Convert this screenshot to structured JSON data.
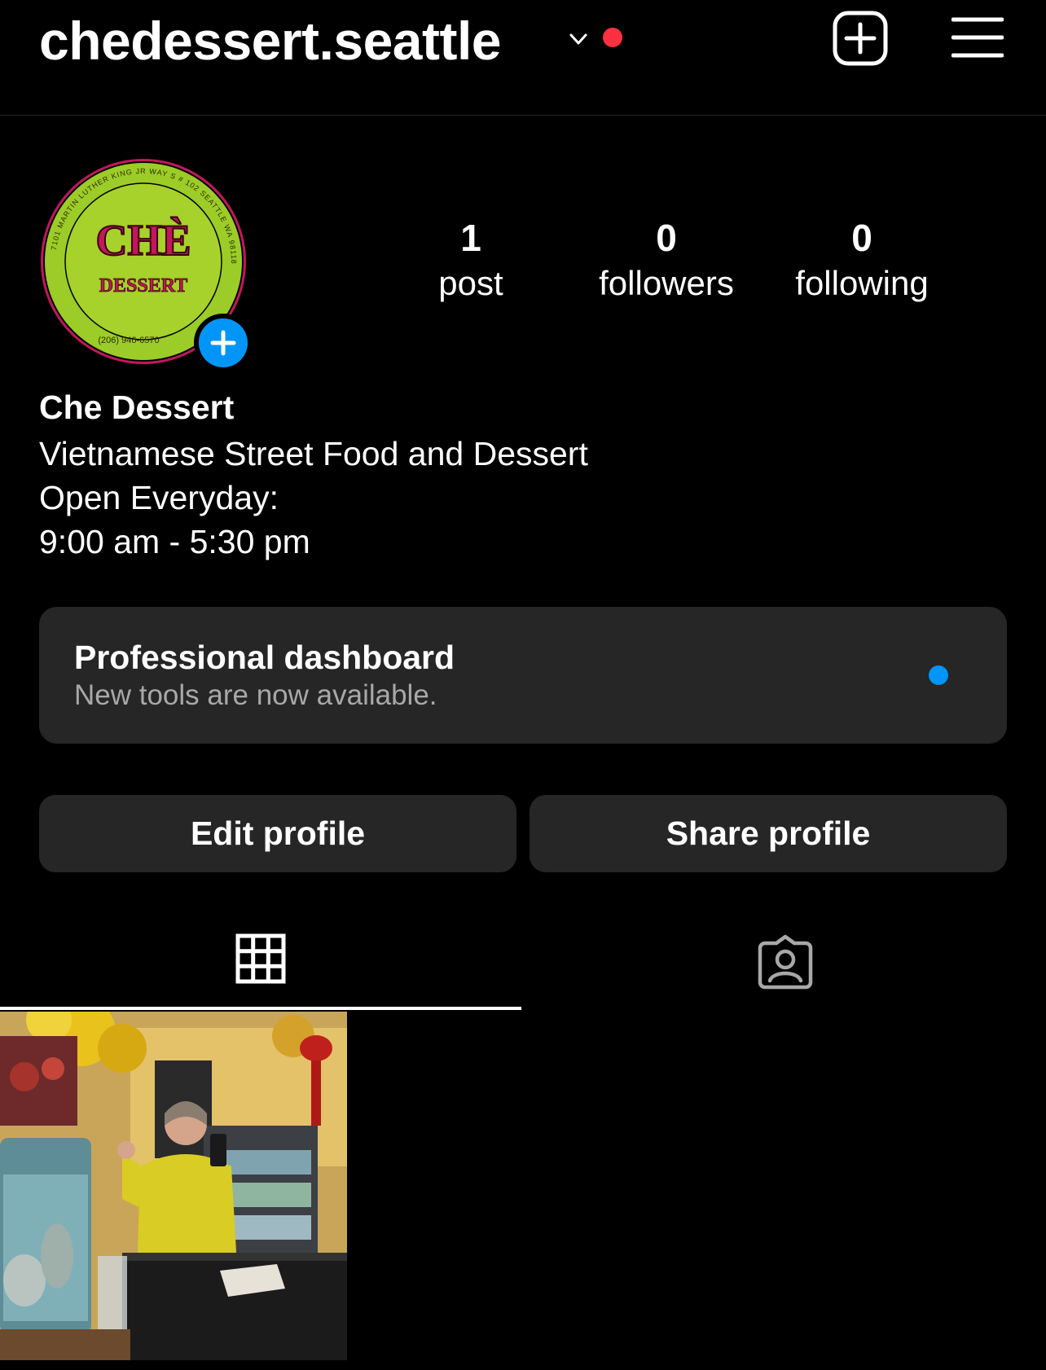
{
  "header": {
    "username": "chedessert.seattle",
    "chevron_icon": "chevron-down-icon",
    "new_post_icon": "plus-square-icon",
    "menu_icon": "hamburger-menu-icon"
  },
  "profile": {
    "avatar_logo": {
      "main_text": "CHÈ",
      "sub_text": "DESSERT",
      "ring_text": "7101 MARTIN LUTHER KING JR WAY S # 102 SEATTLE WA 98118",
      "phone": "(206) 946-6570"
    },
    "stats": [
      {
        "value": "1",
        "label": "post"
      },
      {
        "value": "0",
        "label": "followers"
      },
      {
        "value": "0",
        "label": "following"
      }
    ]
  },
  "bio": {
    "name": "Che Dessert",
    "lines": [
      "Vietnamese Street Food and Dessert",
      "Open Everyday:",
      "9:00 am - 5:30 pm"
    ]
  },
  "dashboard": {
    "title": "Professional dashboard",
    "subtitle": "New tools are now available."
  },
  "actions": {
    "edit_label": "Edit profile",
    "share_label": "Share profile"
  },
  "tabs": [
    {
      "icon": "grid-icon",
      "active": true
    },
    {
      "icon": "tagged-person-icon",
      "active": false
    }
  ],
  "colors": {
    "background": "#000000",
    "surface": "#262626",
    "text": "#ffffff",
    "muted_text": "#a8a8a8",
    "notification_red": "#ff3040",
    "accent_blue": "#0095f6",
    "logo_green": "#a7d12b",
    "logo_pink": "#c2185b"
  }
}
